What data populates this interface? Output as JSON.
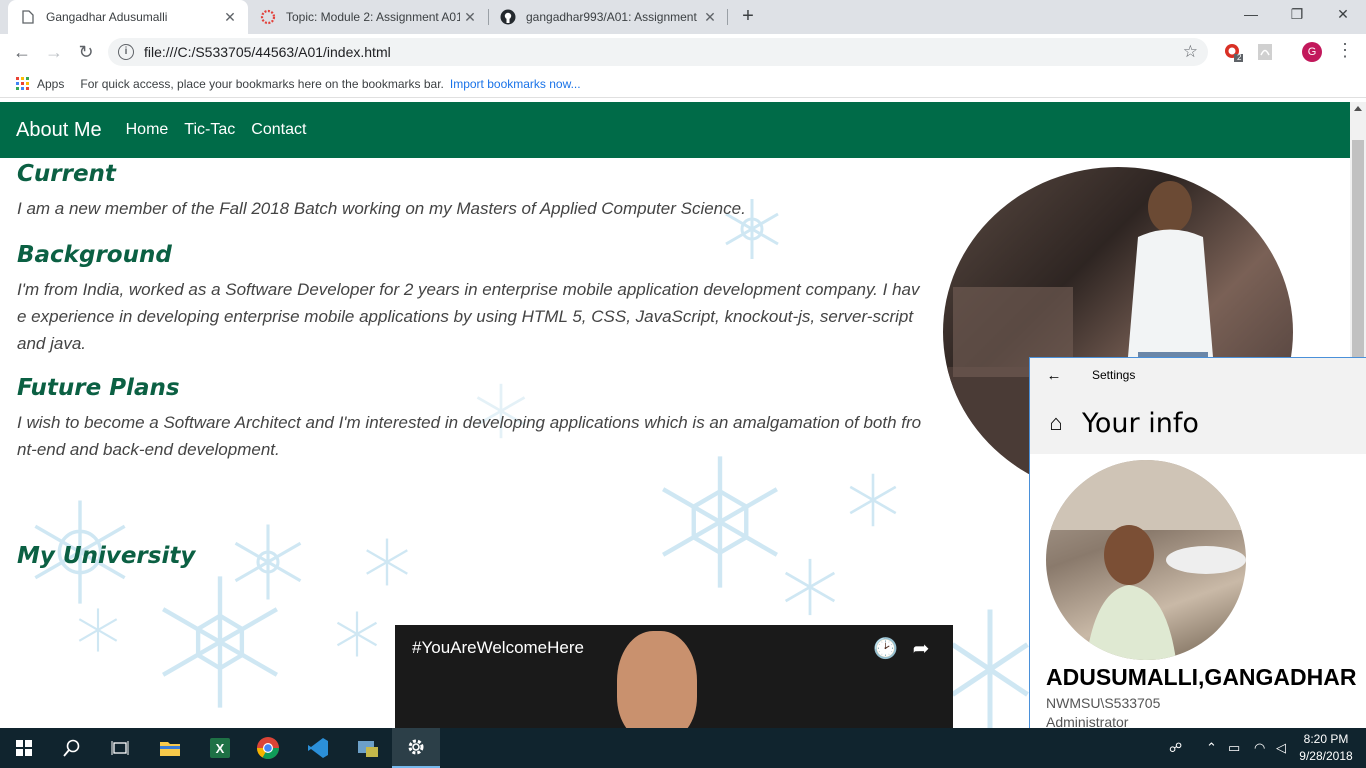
{
  "browser": {
    "tabs": [
      {
        "title": "Gangadhar Adusumalli",
        "icon": "page-icon",
        "active": true
      },
      {
        "title": "Topic: Module 2: Assignment A01",
        "icon": "canvas-icon",
        "active": false
      },
      {
        "title": "gangadhar993/A01: Assignment",
        "icon": "github-icon",
        "active": false
      }
    ],
    "new_tab_label": "+",
    "url": "file:///C:/S533705/44563/A01/index.html",
    "extension_badge": "2",
    "profile_initial": "G"
  },
  "bookmarks": {
    "apps_label": "Apps",
    "hint": "For quick access, place your bookmarks here on the bookmarks bar.",
    "import_link": "Import bookmarks now..."
  },
  "site": {
    "brand": "About Me",
    "nav": [
      "Home",
      "Tic-Tac",
      "Contact"
    ],
    "sections": [
      {
        "heading": "Current",
        "text": "I am a new member of the Fall 2018 Batch working on my Masters of Applied Computer Science."
      },
      {
        "heading": "Background",
        "text": "I'm from India, worked as a Software Developer for 2 years in enterprise mobile application development company. I have experience in developing enterprise mobile applications by using HTML 5, CSS, JavaScript, knockout-js, server-script and java."
      },
      {
        "heading": "Future Plans",
        "text": "I wish to become a Software Architect and I'm interested in developing applications which is an amalgamation of both front-end and back-end development."
      },
      {
        "heading": "My University",
        "text": ""
      }
    ],
    "video_title": "#YouAreWelcomeHere"
  },
  "settings_window": {
    "title": "Settings",
    "page_heading": "Your info",
    "user_name": "ADUSUMALLI,GANGADHAR",
    "user_id": "NWMSU\\S533705",
    "role": "Administrator"
  },
  "taskbar": {
    "apps": [
      "windows-start-icon",
      "search-icon",
      "task-view-icon",
      "file-explorer-icon",
      "excel-icon",
      "chrome-icon",
      "vscode-icon",
      "app-icon",
      "settings-icon"
    ],
    "time": "8:20 PM",
    "date": "9/28/2018"
  },
  "colors": {
    "nav_green": "#006b48",
    "heading_green": "#0b6043",
    "taskbar": "#10242e"
  }
}
